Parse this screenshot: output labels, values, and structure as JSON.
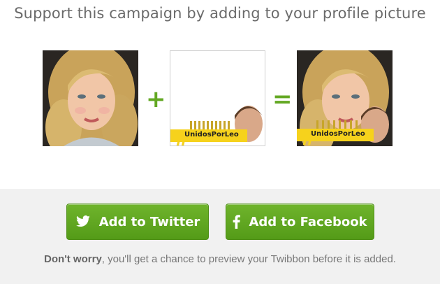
{
  "heading": "Support this campaign by adding to your profile picture",
  "operators": {
    "plus": "+",
    "equals": "="
  },
  "twibbon": {
    "hashtag_symbol": "#",
    "tag": "UnidosPorLeo"
  },
  "buttons": {
    "twitter": {
      "label": "Add to Twitter",
      "icon": "twitter-bird-icon"
    },
    "facebook": {
      "label": "Add to Facebook",
      "icon": "facebook-f-icon"
    }
  },
  "note": {
    "strong": "Don't worry",
    "rest": ", you'll get a chance to preview your Twibbon before it is added."
  },
  "colors": {
    "accent_green": "#63a823",
    "button_green": "#5fa81e",
    "heading_gray": "#6a6a6a",
    "panel_bg": "#f1f1f1",
    "hashtag_yellow": "#f6d21c"
  }
}
